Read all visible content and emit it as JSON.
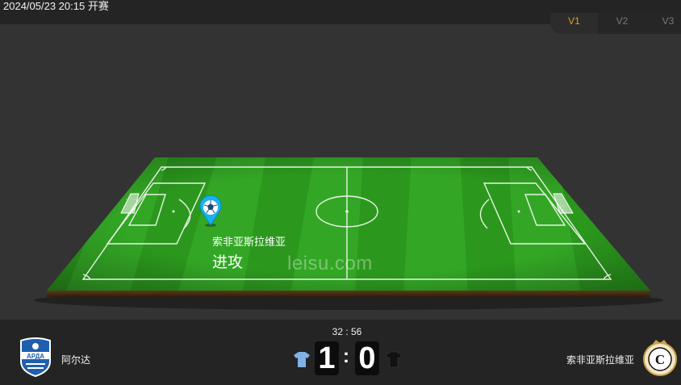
{
  "header": {
    "match_time": "2024/05/23 20:15 开赛"
  },
  "view_tabs": [
    {
      "label": "V1",
      "active": true
    },
    {
      "label": "V2",
      "active": false
    },
    {
      "label": "V3",
      "active": false
    }
  ],
  "pitch": {
    "watermark": "leisu.com",
    "event": {
      "team": "索非亚斯拉维亚",
      "action": "进攻"
    }
  },
  "scoreboard": {
    "clock": "32 : 56",
    "home": {
      "name": "阿尔达",
      "score": "1",
      "logo_text": "АРДА",
      "jersey_color": "#7fb3e6"
    },
    "away": {
      "name": "索非亚斯拉维亚",
      "score": "0",
      "logo_text": "C",
      "jersey_color": "#111111"
    },
    "separator": ":"
  },
  "colors": {
    "active_tab": "#e3a51b",
    "pitch_green": "#2a9a1e",
    "marker": "#1ab1f0"
  }
}
